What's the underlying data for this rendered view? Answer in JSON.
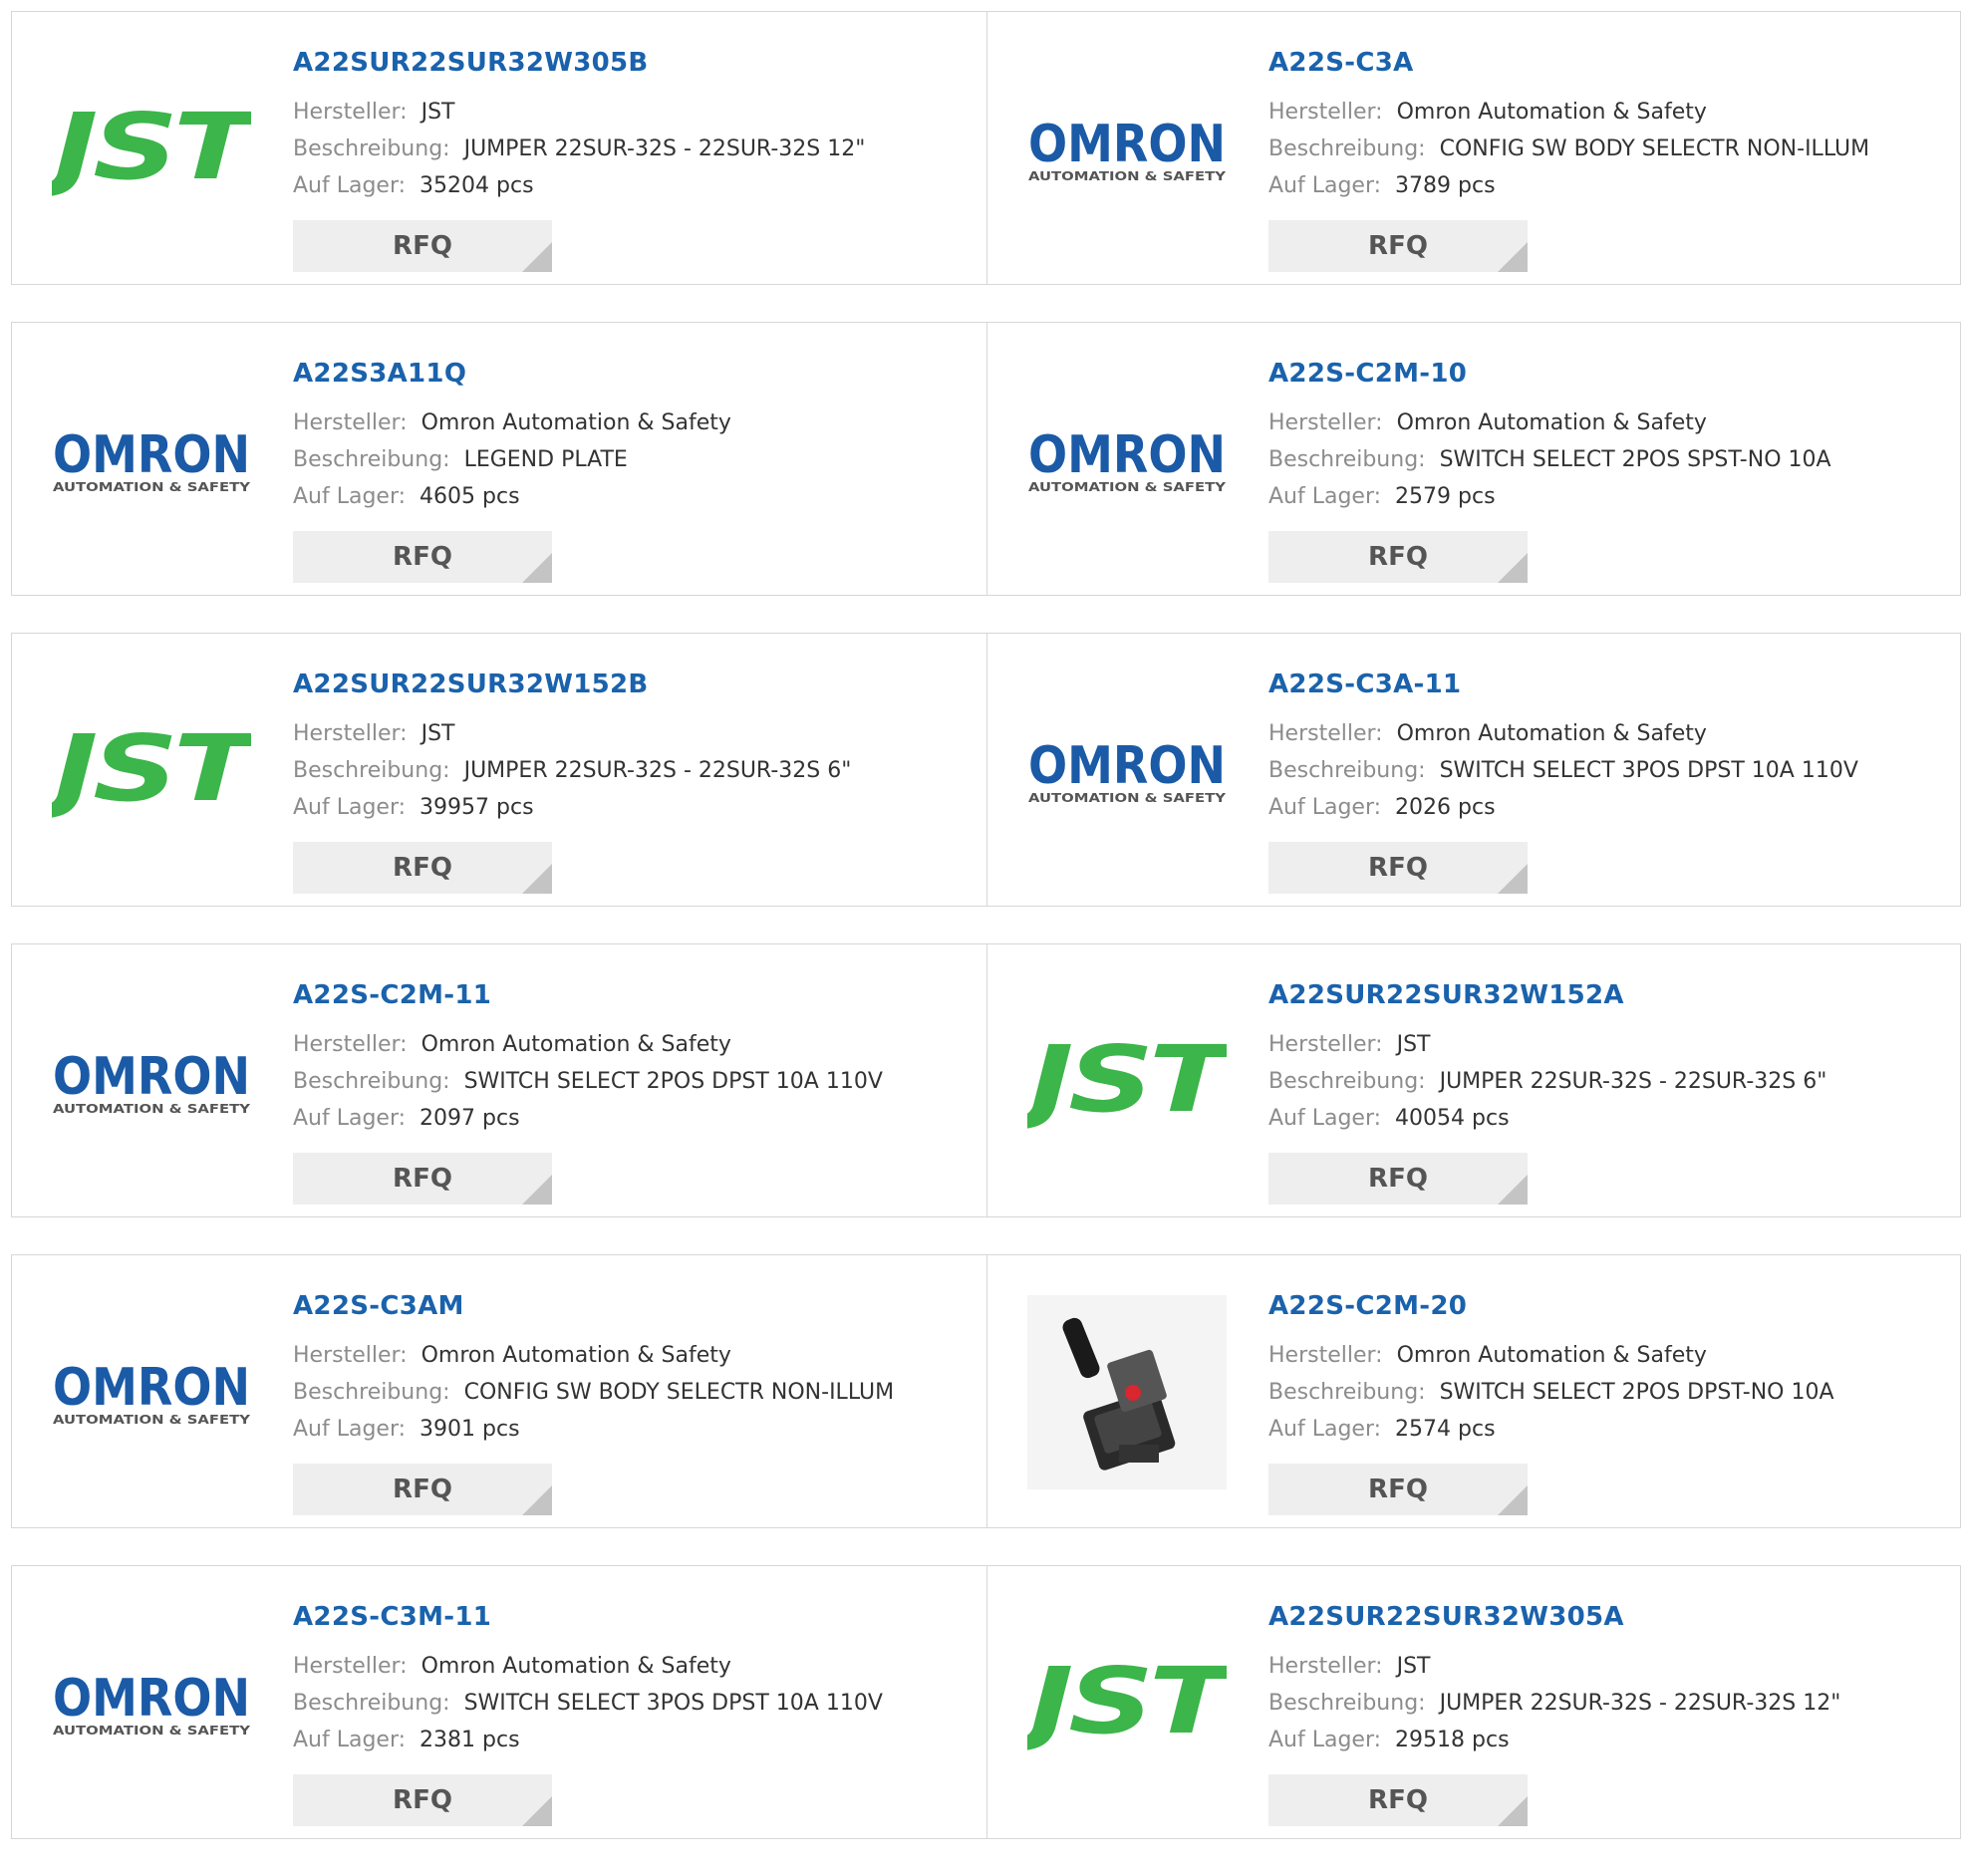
{
  "labels": {
    "manufacturer": "Hersteller:",
    "description": "Beschreibung:",
    "stock": "Auf Lager:",
    "rfq": "RFQ"
  },
  "logos": {
    "jst": {
      "text": "JST",
      "color": "#3cb54a"
    },
    "omron": {
      "text": "OMRON",
      "subtext": "AUTOMATION & SAFETY",
      "color": "#1a5aa6",
      "subcolor": "#555555"
    }
  },
  "products": [
    {
      "part": "A22SUR22SUR32W305B",
      "logo": "jst",
      "manufacturer": "JST",
      "description": "JUMPER 22SUR-32S - 22SUR-32S 12\"",
      "stock": "35204 pcs"
    },
    {
      "part": "A22S-C3A",
      "logo": "omron",
      "manufacturer": "Omron Automation & Safety",
      "description": "CONFIG SW BODY SELECTR NON-ILLUM",
      "stock": "3789 pcs"
    },
    {
      "part": "A22S3A11Q",
      "logo": "omron",
      "manufacturer": "Omron Automation & Safety",
      "description": "LEGEND PLATE",
      "stock": "4605 pcs"
    },
    {
      "part": "A22S-C2M-10",
      "logo": "omron",
      "manufacturer": "Omron Automation & Safety",
      "description": "SWITCH SELECT 2POS SPST-NO 10A",
      "stock": "2579 pcs"
    },
    {
      "part": "A22SUR22SUR32W152B",
      "logo": "jst",
      "manufacturer": "JST",
      "description": "JUMPER 22SUR-32S - 22SUR-32S 6\"",
      "stock": "39957 pcs"
    },
    {
      "part": "A22S-C3A-11",
      "logo": "omron",
      "manufacturer": "Omron Automation & Safety",
      "description": "SWITCH SELECT 3POS DPST 10A 110V",
      "stock": "2026 pcs"
    },
    {
      "part": "A22S-C2M-11",
      "logo": "omron",
      "manufacturer": "Omron Automation & Safety",
      "description": "SWITCH SELECT 2POS DPST 10A 110V",
      "stock": "2097 pcs"
    },
    {
      "part": "A22SUR22SUR32W152A",
      "logo": "jst",
      "manufacturer": "JST",
      "description": "JUMPER 22SUR-32S - 22SUR-32S 6\"",
      "stock": "40054 pcs"
    },
    {
      "part": "A22S-C3AM",
      "logo": "omron",
      "manufacturer": "Omron Automation & Safety",
      "description": "CONFIG SW BODY SELECTR NON-ILLUM",
      "stock": "3901 pcs"
    },
    {
      "part": "A22S-C2M-20",
      "logo": "photo",
      "manufacturer": "Omron Automation & Safety",
      "description": "SWITCH SELECT 2POS DPST-NO 10A",
      "stock": "2574 pcs"
    },
    {
      "part": "A22S-C3M-11",
      "logo": "omron",
      "manufacturer": "Omron Automation & Safety",
      "description": "SWITCH SELECT 3POS DPST 10A 110V",
      "stock": "2381 pcs"
    },
    {
      "part": "A22SUR22SUR32W305A",
      "logo": "jst",
      "manufacturer": "JST",
      "description": "JUMPER 22SUR-32S - 22SUR-32S 12\"",
      "stock": "29518 pcs"
    }
  ]
}
